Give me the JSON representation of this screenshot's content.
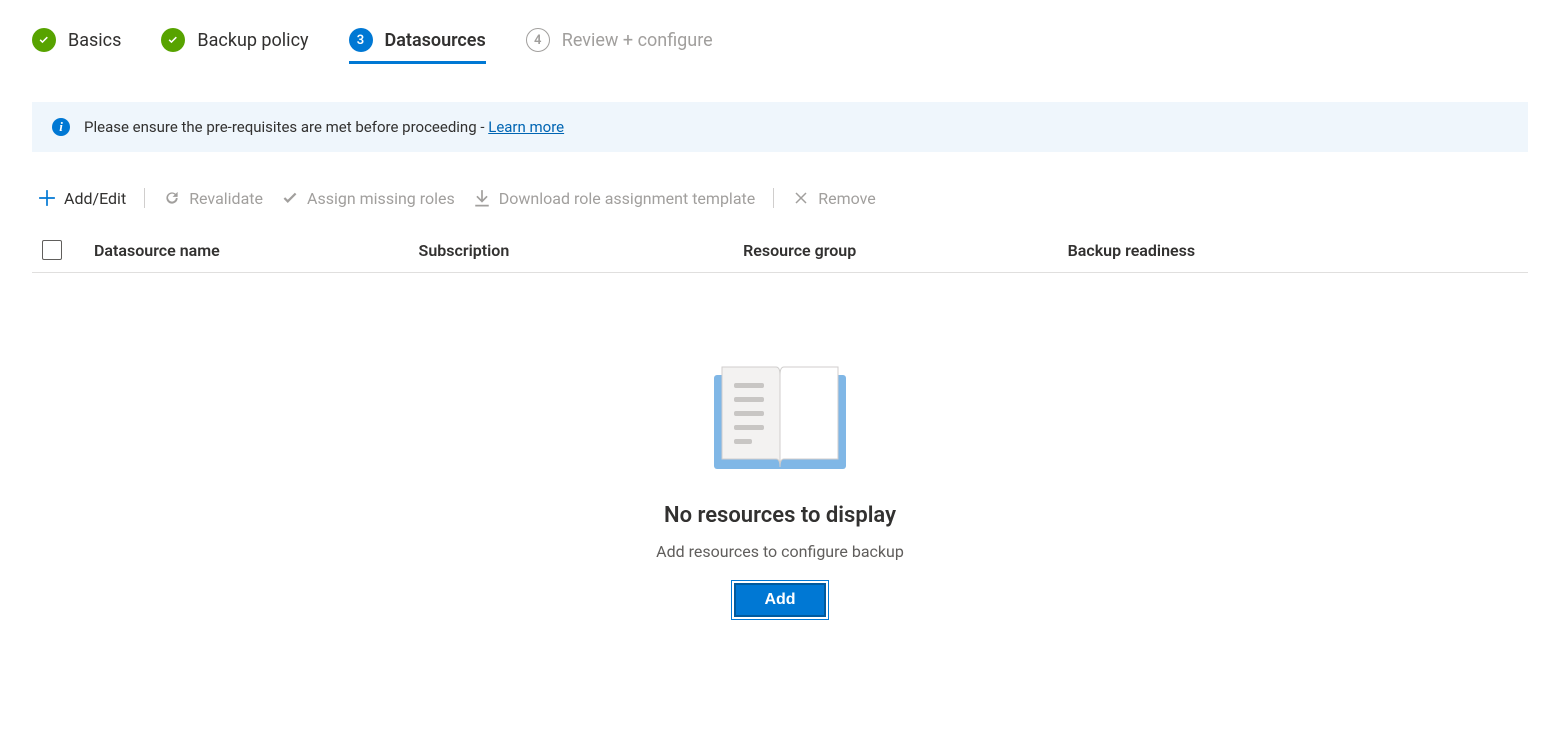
{
  "stepper": {
    "steps": [
      {
        "label": "Basics",
        "state": "done"
      },
      {
        "label": "Backup policy",
        "state": "done"
      },
      {
        "label": "Datasources",
        "state": "active",
        "num": "3"
      },
      {
        "label": "Review + configure",
        "state": "inactive",
        "num": "4"
      }
    ]
  },
  "info_banner": {
    "text": "Please ensure the pre-requisites are met before proceeding - ",
    "link_label": "Learn more"
  },
  "toolbar": {
    "add_edit": "Add/Edit",
    "revalidate": "Revalidate",
    "assign_roles": "Assign missing roles",
    "download_template": "Download role assignment template",
    "remove": "Remove"
  },
  "table": {
    "columns": {
      "name": "Datasource name",
      "subscription": "Subscription",
      "resource_group": "Resource group",
      "backup_readiness": "Backup readiness"
    }
  },
  "empty_state": {
    "title": "No resources to display",
    "description": "Add resources to configure backup",
    "button": "Add"
  }
}
